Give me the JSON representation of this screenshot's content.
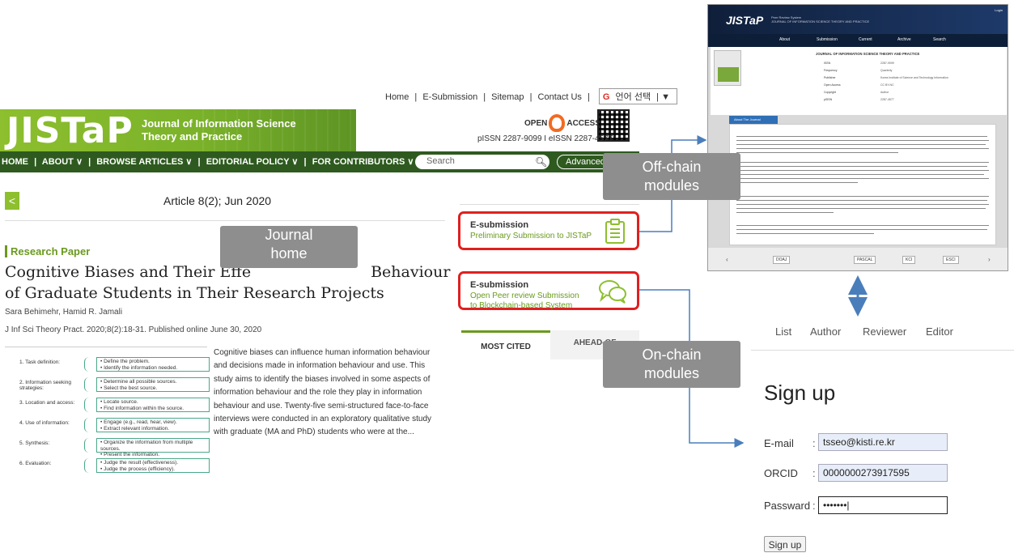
{
  "journal": {
    "top_links": [
      "Home",
      "|",
      "E-Submission",
      "|",
      "Sitemap",
      "|",
      "Contact Us",
      "|"
    ],
    "lang_label": "언어 선택",
    "lang_caret": "▼",
    "logo": "JISTaP",
    "logo_sub_1": "Journal of Information Science",
    "logo_sub_2": "Theory and Practice",
    "open_access_1": "OPEN",
    "open_access_2": "ACCESS",
    "issn": "pISSN 2287-9099  I  eISSN 2287-4577",
    "nav": [
      "HOME",
      "|",
      "ABOUT ∨",
      "|",
      "BROWSE ARTICLES ∨",
      "|",
      "EDITORIAL POLICY ∨",
      "|",
      "FOR CONTRIBUTORS ∨"
    ],
    "search_placeholder": "Search",
    "advanced": "Advanced",
    "back": "<",
    "article_num": "Article 8(2); Jun 2020",
    "research_paper": "Research Paper",
    "title_line1": "Cognitive Biases and Their Effe",
    "title_line1_end": "Behaviour",
    "title_line2": "of Graduate Students in Their Research Projects",
    "authors": "Sara Behimehr, Hamid R. Jamali",
    "citation": "J Inf Sci Theory Pract. 2020;8(2):18-31.  Published online June 30, 2020",
    "abstract": "Cognitive biases can influence human information behaviour and decisions made in information behaviour and use. This study aims to identify the biases involved in some aspects of information behaviour and the role they play in information behaviour and use. Twenty-five semi-structured face-to-face interviews were conducted in an exploratory qualitative study with graduate (MA and PhD) students who were at the...",
    "figure": [
      {
        "step": "1. Task definition:",
        "items": "• Define the problem.\n• Identify the information needed."
      },
      {
        "step": "2. Information seeking strategies:",
        "items": "• Determine all possible sources.\n• Select the best source."
      },
      {
        "step": "3. Location and access:",
        "items": "• Locate source.\n• Find information within the source."
      },
      {
        "step": "4. Use of information:",
        "items": "• Engage (e.g., read, hear, view).\n• Extract relevant information."
      },
      {
        "step": "5. Synthesis:",
        "items": "• Organize the information from multiple sources.\n• Present the information."
      },
      {
        "step": "6. Evaluation:",
        "items": "• Judge the result (effectiveness).\n• Judge the process (efficiency)."
      }
    ],
    "esub1_title": "E-submission",
    "esub1_link": "Preliminary Submission to JISTaP",
    "esub2_title": "E-submission",
    "esub2_link_1": "Open Peer review Submission",
    "esub2_link_2": "to Blockchain-based System",
    "tab_most_cited": "MOST CITED",
    "tab_ahead": "AHEAD-OF"
  },
  "labels": {
    "journal_home": "Journal\nhome",
    "off_chain": "Off-chain\nmodules",
    "on_chain": "On-chain\nmodules"
  },
  "peer_site": {
    "logo": "JISTaP",
    "sub_1": "Peer Review System",
    "sub_2": "JOURNAL OF INFORMATION SCIENCE THEORY AND PRACTICE",
    "login": "Login",
    "nav": [
      "About",
      "Submission",
      "Current",
      "Archive",
      "Search"
    ],
    "info_title": "JOURNAL OF INFORMATION SCIENCE THEORY AND PRACTICE",
    "info_rows": [
      {
        "k": "ISSN",
        "v": "2287-9099"
      },
      {
        "k": "Frequency",
        "v": "Quarterly"
      },
      {
        "k": "Publisher",
        "v": "Korea Institute of Science and Technology Information"
      },
      {
        "k": "Open Access",
        "v": "CC BY-NC"
      },
      {
        "k": "Copyright",
        "v": "Author"
      },
      {
        "k": "pISSN",
        "v": "2287-4577"
      }
    ],
    "about_tab": "About The Journal",
    "footer_logos": [
      "DOAJ",
      "PASCAL",
      "KCI",
      "ESCI"
    ]
  },
  "signup": {
    "tabs": [
      "List",
      "Author",
      "Reviewer",
      "Editor"
    ],
    "title": "Sign up",
    "email_label": "E-mail",
    "email_value": "tsseo@kisti.re.kr",
    "orcid_label": "ORCID",
    "orcid_value": "0000000273917595",
    "password_label": "Passward",
    "password_value": "•••••••|",
    "button": "Sign up",
    "colon": ":"
  },
  "colors": {
    "jistap_green": "#7bb22a",
    "nav_green": "#2e5a1f",
    "highlight_red": "#e02020",
    "arrow_blue": "#4a7ebb",
    "label_grey": "#8e8e8e"
  }
}
